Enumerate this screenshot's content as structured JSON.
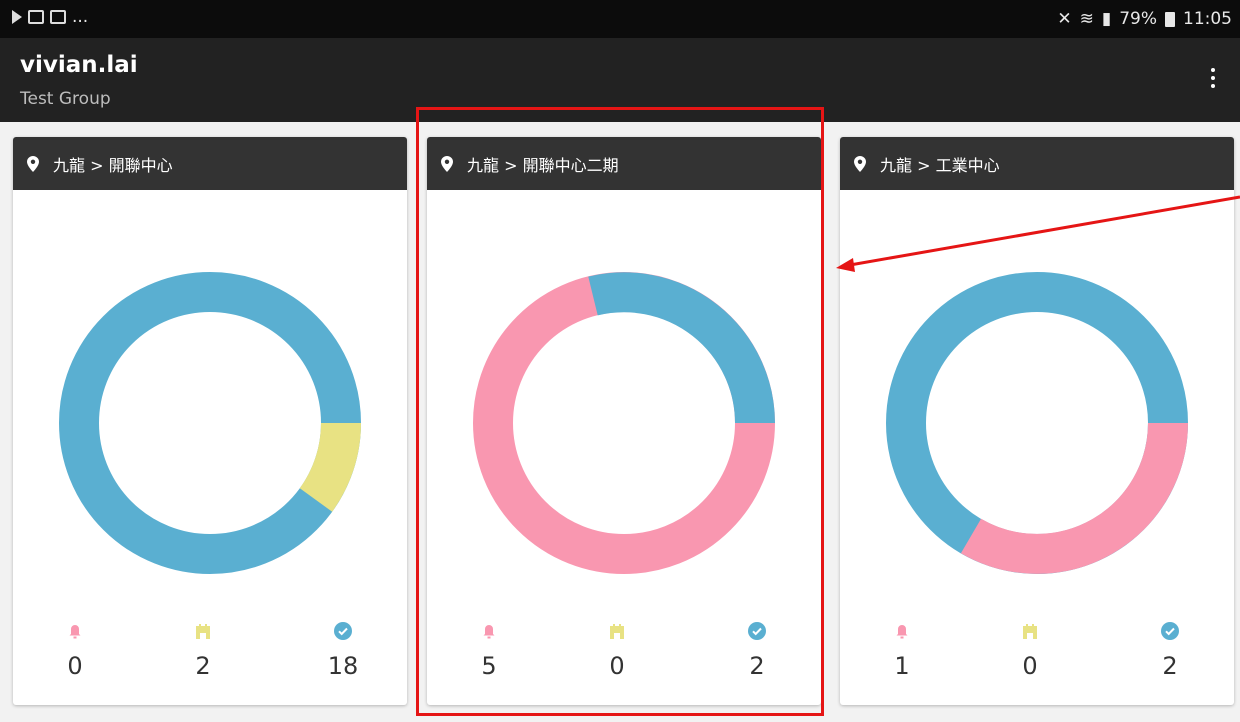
{
  "status_bar": {
    "left_icons": [
      "play-store-icon",
      "gallery-icon",
      "image-icon"
    ],
    "left_more": "...",
    "right_icons": [
      "mute-icon",
      "wifi-icon",
      "signal-icon"
    ],
    "battery": "79%",
    "time": "11:05"
  },
  "app_bar": {
    "title": "vivian.lai",
    "subtitle": "Test Group",
    "menu_icon": "more-vert-icon"
  },
  "colors": {
    "blue": "#5aafd1",
    "pink": "#f997b0",
    "yellow": "#e8e283",
    "header": "#333333",
    "annotation_red": "#e51515"
  },
  "cards": [
    {
      "location": "九龍 > 開聯中心",
      "counts": {
        "alert": "0",
        "fault": "2",
        "normal": "18"
      }
    },
    {
      "location": "九龍 > 開聯中心二期",
      "counts": {
        "alert": "5",
        "fault": "0",
        "normal": "2"
      }
    },
    {
      "location": "九龍 > 工業中心",
      "counts": {
        "alert": "1",
        "fault": "0",
        "normal": "2"
      }
    }
  ],
  "stat_icons": [
    "bell-icon",
    "gate-icon",
    "check-circle-icon"
  ]
}
